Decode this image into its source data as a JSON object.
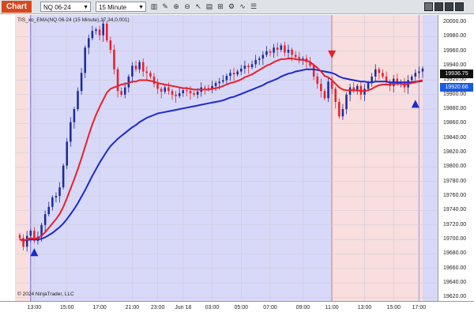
{
  "toolbar": {
    "tab_label": "Chart",
    "instrument": "NQ 06-24",
    "interval": "15 Minute",
    "icons": [
      "bar-type-icon",
      "draw-icon",
      "zoom-in-icon",
      "zoom-out-icon",
      "pointer-icon",
      "properties-icon",
      "templates-icon",
      "strategy-icon",
      "indicator-icon",
      "list-icon"
    ]
  },
  "indicator_label": "TIS_xo_EMA(NQ 06-24 (15 Minute),17,34,0.001)",
  "copyright": "© 2024 NinjaTrader, LLC",
  "price_tags": {
    "last": "19936.75",
    "ema": "19920.66"
  },
  "colors": {
    "bull_zone": "#d8d8f8",
    "bear_zone": "#f8dede",
    "fast_ema": "#e8202a",
    "slow_ema": "#1a2ad0",
    "candle_up": "#1c2a9a",
    "candle_down": "#e8202a",
    "last_tag": "#111111",
    "ema_tag": "#1a5adf"
  },
  "chart_data": {
    "type": "candlestick",
    "ylim": [
      19615,
      20010
    ],
    "yticks": [
      "20000.00",
      "19980.00",
      "19960.00",
      "19940.00",
      "19920.00",
      "19900.00",
      "19880.00",
      "19860.00",
      "19840.00",
      "19820.00",
      "19800.00",
      "19780.00",
      "19760.00",
      "19740.00",
      "19720.00",
      "19700.00",
      "19680.00",
      "19660.00",
      "19640.00",
      "19620.00"
    ],
    "xticks": [
      "13:00",
      "15:00",
      "17:00",
      "21:00",
      "23:00",
      "Jun 18",
      "03:00",
      "05:00",
      "07:00",
      "09:00",
      "11:00",
      "13:00",
      "15:00",
      "17:00"
    ],
    "closes": [
      19702,
      19690,
      19705,
      19712,
      19698,
      19704,
      19720,
      19735,
      19745,
      19758,
      19760,
      19772,
      19802,
      19835,
      19862,
      19880,
      19905,
      19930,
      19965,
      19978,
      19988,
      19990,
      19982,
      19998,
      19975,
      19962,
      19935,
      19905,
      19900,
      19910,
      19925,
      19940,
      19935,
      19945,
      19932,
      19930,
      19925,
      19915,
      19908,
      19904,
      19910,
      19905,
      19900,
      19898,
      19902,
      19906,
      19905,
      19902,
      19900,
      19904,
      19910,
      19909,
      19907,
      19912,
      19916,
      19918,
      19920,
      19926,
      19930,
      19928,
      19932,
      19936,
      19940,
      19938,
      19942,
      19948,
      19950,
      19955,
      19960,
      19958,
      19965,
      19962,
      19968,
      19958,
      19962,
      19955,
      19952,
      19948,
      19950,
      19945,
      19940,
      19925,
      19915,
      19905,
      19895,
      19918,
      19908,
      19890,
      19870,
      19880,
      19900,
      19910,
      19905,
      19912,
      19900,
      19908,
      19916,
      19925,
      19935,
      19930,
      19925,
      19918,
      19912,
      19922,
      19915,
      19918,
      19910,
      19920,
      19925,
      19930,
      19932,
      19936
    ],
    "fast_ema": [
      19700,
      19698,
      19700,
      19702,
      19701,
      19702,
      19705,
      19710,
      19716,
      19722,
      19728,
      19735,
      19745,
      19757,
      19770,
      19783,
      19797,
      19812,
      19828,
      19844,
      19859,
      19872,
      19883,
      19893,
      19903,
      19908,
      19910,
      19912,
      19914,
      19915,
      19916,
      19918,
      19918,
      19920,
      19920,
      19920,
      19919,
      19918,
      19916,
      19915,
      19914,
      19913,
      19912,
      19911,
      19910,
      19909,
      19909,
      19908,
      19907,
      19907,
      19907,
      19907,
      19907,
      19908,
      19909,
      19910,
      19912,
      19914,
      19916,
      19917,
      19919,
      19921,
      19924,
      19926,
      19928,
      19931,
      19934,
      19937,
      19940,
      19942,
      19945,
      19947,
      19949,
      19949,
      19950,
      19950,
      19949,
      19948,
      19948,
      19947,
      19945,
      19941,
      19937,
      19932,
      19926,
      19924,
      19920,
      19915,
      19910,
      19907,
      19906,
      19906,
      19906,
      19906,
      19905,
      19905,
      19906,
      19908,
      19911,
      19913,
      19914,
      19914,
      19914,
      19915,
      19915,
      19915,
      19914,
      19915,
      19916,
      19917,
      19919,
      19920
    ],
    "slow_ema": [
      19700,
      19699,
      19699,
      19700,
      19700,
      19700,
      19701,
      19703,
      19706,
      19709,
      19713,
      19717,
      19722,
      19728,
      19735,
      19742,
      19750,
      19759,
      19768,
      19778,
      19788,
      19797,
      19806,
      19814,
      19822,
      19829,
      19834,
      19839,
      19843,
      19847,
      19851,
      19855,
      19858,
      19862,
      19865,
      19868,
      19870,
      19872,
      19874,
      19875,
      19876,
      19877,
      19878,
      19879,
      19880,
      19881,
      19882,
      19883,
      19884,
      19885,
      19886,
      19887,
      19888,
      19889,
      19890,
      19891,
      19892,
      19894,
      19896,
      19897,
      19899,
      19901,
      19903,
      19905,
      19907,
      19909,
      19911,
      19913,
      19916,
      19918,
      19920,
      19922,
      19925,
      19927,
      19929,
      19930,
      19932,
      19933,
      19934,
      19935,
      19935,
      19935,
      19934,
      19933,
      19932,
      19931,
      19930,
      19928,
      19925,
      19923,
      19922,
      19921,
      19920,
      19919,
      19918,
      19918,
      19917,
      19917,
      19918,
      19918,
      19918,
      19918,
      19917,
      19917,
      19917,
      19917,
      19917,
      19917,
      19917,
      19918,
      19918,
      19919
    ]
  }
}
